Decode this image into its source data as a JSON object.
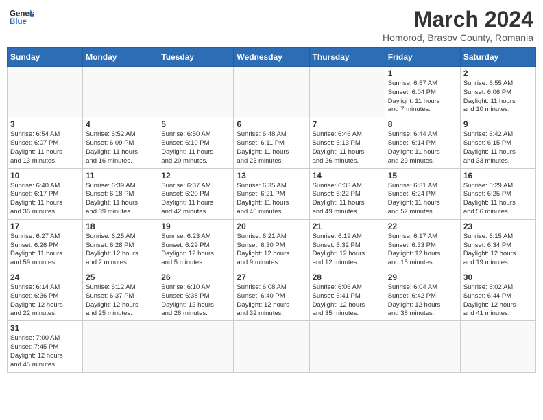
{
  "header": {
    "logo_general": "General",
    "logo_blue": "Blue",
    "month_title": "March 2024",
    "subtitle": "Homorod, Brasov County, Romania"
  },
  "weekdays": [
    "Sunday",
    "Monday",
    "Tuesday",
    "Wednesday",
    "Thursday",
    "Friday",
    "Saturday"
  ],
  "weeks": [
    [
      {
        "day": "",
        "info": ""
      },
      {
        "day": "",
        "info": ""
      },
      {
        "day": "",
        "info": ""
      },
      {
        "day": "",
        "info": ""
      },
      {
        "day": "",
        "info": ""
      },
      {
        "day": "1",
        "info": "Sunrise: 6:57 AM\nSunset: 6:04 PM\nDaylight: 11 hours\nand 7 minutes."
      },
      {
        "day": "2",
        "info": "Sunrise: 6:55 AM\nSunset: 6:06 PM\nDaylight: 11 hours\nand 10 minutes."
      }
    ],
    [
      {
        "day": "3",
        "info": "Sunrise: 6:54 AM\nSunset: 6:07 PM\nDaylight: 11 hours\nand 13 minutes."
      },
      {
        "day": "4",
        "info": "Sunrise: 6:52 AM\nSunset: 6:09 PM\nDaylight: 11 hours\nand 16 minutes."
      },
      {
        "day": "5",
        "info": "Sunrise: 6:50 AM\nSunset: 6:10 PM\nDaylight: 11 hours\nand 20 minutes."
      },
      {
        "day": "6",
        "info": "Sunrise: 6:48 AM\nSunset: 6:11 PM\nDaylight: 11 hours\nand 23 minutes."
      },
      {
        "day": "7",
        "info": "Sunrise: 6:46 AM\nSunset: 6:13 PM\nDaylight: 11 hours\nand 26 minutes."
      },
      {
        "day": "8",
        "info": "Sunrise: 6:44 AM\nSunset: 6:14 PM\nDaylight: 11 hours\nand 29 minutes."
      },
      {
        "day": "9",
        "info": "Sunrise: 6:42 AM\nSunset: 6:15 PM\nDaylight: 11 hours\nand 33 minutes."
      }
    ],
    [
      {
        "day": "10",
        "info": "Sunrise: 6:40 AM\nSunset: 6:17 PM\nDaylight: 11 hours\nand 36 minutes."
      },
      {
        "day": "11",
        "info": "Sunrise: 6:39 AM\nSunset: 6:18 PM\nDaylight: 11 hours\nand 39 minutes."
      },
      {
        "day": "12",
        "info": "Sunrise: 6:37 AM\nSunset: 6:20 PM\nDaylight: 11 hours\nand 42 minutes."
      },
      {
        "day": "13",
        "info": "Sunrise: 6:35 AM\nSunset: 6:21 PM\nDaylight: 11 hours\nand 46 minutes."
      },
      {
        "day": "14",
        "info": "Sunrise: 6:33 AM\nSunset: 6:22 PM\nDaylight: 11 hours\nand 49 minutes."
      },
      {
        "day": "15",
        "info": "Sunrise: 6:31 AM\nSunset: 6:24 PM\nDaylight: 11 hours\nand 52 minutes."
      },
      {
        "day": "16",
        "info": "Sunrise: 6:29 AM\nSunset: 6:25 PM\nDaylight: 11 hours\nand 56 minutes."
      }
    ],
    [
      {
        "day": "17",
        "info": "Sunrise: 6:27 AM\nSunset: 6:26 PM\nDaylight: 11 hours\nand 59 minutes."
      },
      {
        "day": "18",
        "info": "Sunrise: 6:25 AM\nSunset: 6:28 PM\nDaylight: 12 hours\nand 2 minutes."
      },
      {
        "day": "19",
        "info": "Sunrise: 6:23 AM\nSunset: 6:29 PM\nDaylight: 12 hours\nand 5 minutes."
      },
      {
        "day": "20",
        "info": "Sunrise: 6:21 AM\nSunset: 6:30 PM\nDaylight: 12 hours\nand 9 minutes."
      },
      {
        "day": "21",
        "info": "Sunrise: 6:19 AM\nSunset: 6:32 PM\nDaylight: 12 hours\nand 12 minutes."
      },
      {
        "day": "22",
        "info": "Sunrise: 6:17 AM\nSunset: 6:33 PM\nDaylight: 12 hours\nand 15 minutes."
      },
      {
        "day": "23",
        "info": "Sunrise: 6:15 AM\nSunset: 6:34 PM\nDaylight: 12 hours\nand 19 minutes."
      }
    ],
    [
      {
        "day": "24",
        "info": "Sunrise: 6:14 AM\nSunset: 6:36 PM\nDaylight: 12 hours\nand 22 minutes."
      },
      {
        "day": "25",
        "info": "Sunrise: 6:12 AM\nSunset: 6:37 PM\nDaylight: 12 hours\nand 25 minutes."
      },
      {
        "day": "26",
        "info": "Sunrise: 6:10 AM\nSunset: 6:38 PM\nDaylight: 12 hours\nand 28 minutes."
      },
      {
        "day": "27",
        "info": "Sunrise: 6:08 AM\nSunset: 6:40 PM\nDaylight: 12 hours\nand 32 minutes."
      },
      {
        "day": "28",
        "info": "Sunrise: 6:06 AM\nSunset: 6:41 PM\nDaylight: 12 hours\nand 35 minutes."
      },
      {
        "day": "29",
        "info": "Sunrise: 6:04 AM\nSunset: 6:42 PM\nDaylight: 12 hours\nand 38 minutes."
      },
      {
        "day": "30",
        "info": "Sunrise: 6:02 AM\nSunset: 6:44 PM\nDaylight: 12 hours\nand 41 minutes."
      }
    ],
    [
      {
        "day": "31",
        "info": "Sunrise: 7:00 AM\nSunset: 7:45 PM\nDaylight: 12 hours\nand 45 minutes."
      },
      {
        "day": "",
        "info": ""
      },
      {
        "day": "",
        "info": ""
      },
      {
        "day": "",
        "info": ""
      },
      {
        "day": "",
        "info": ""
      },
      {
        "day": "",
        "info": ""
      },
      {
        "day": "",
        "info": ""
      }
    ]
  ]
}
